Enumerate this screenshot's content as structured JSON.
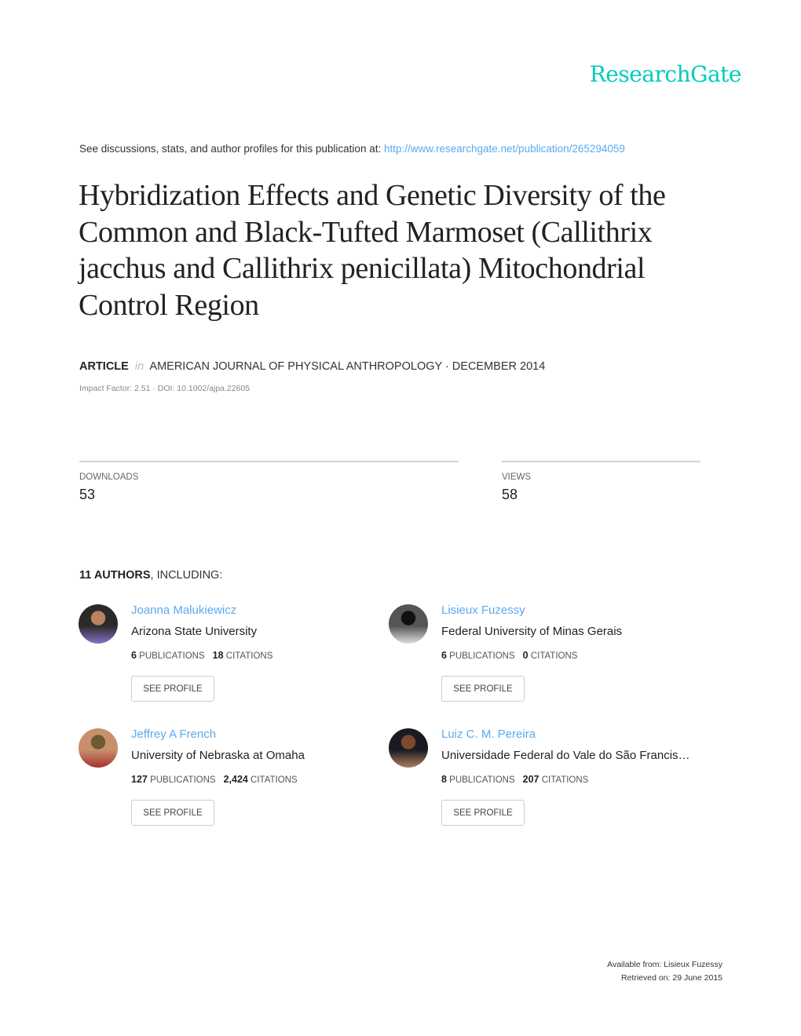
{
  "brand": {
    "name": "ResearchGate",
    "color": "#00ccbb"
  },
  "header": {
    "prefix": "See discussions, stats, and author profiles for this publication at: ",
    "url": "http://www.researchgate.net/publication/265294059"
  },
  "publication": {
    "title": "Hybridization Effects and Genetic Diversity of the Common and Black-Tufted Marmoset (Callithrix jacchus and Callithrix penicillata) Mitochondrial Control Region",
    "type": "ARTICLE",
    "in_label": "in",
    "venue": "AMERICAN JOURNAL OF PHYSICAL ANTHROPOLOGY · DECEMBER 2014",
    "impact_line": "Impact Factor: 2.51 · DOI: 10.1002/ajpa.22605"
  },
  "stats": {
    "downloads_label": "DOWNLOADS",
    "downloads_value": "53",
    "views_label": "VIEWS",
    "views_value": "58"
  },
  "authors_section": {
    "count_label": "11 AUTHORS",
    "suffix": ", INCLUDING:"
  },
  "authors": [
    {
      "name": "Joanna Malukiewicz",
      "institution": "Arizona State University",
      "publications": "6",
      "citations": "18",
      "publications_label": "PUBLICATIONS",
      "citations_label": "CITATIONS",
      "button": "SEE PROFILE",
      "avatar_colors": [
        "#b9835e",
        "#2a2a2a",
        "#8a6fc9"
      ]
    },
    {
      "name": "Lisieux Fuzessy",
      "institution": "Federal University of Minas Gerais",
      "publications": "6",
      "citations": "0",
      "publications_label": "PUBLICATIONS",
      "citations_label": "CITATIONS",
      "button": "SEE PROFILE",
      "avatar_colors": [
        "#111111",
        "#555555",
        "#dddddd"
      ]
    },
    {
      "name": "Jeffrey A French",
      "institution": "University of Nebraska at Omaha",
      "publications": "127",
      "citations": "2,424",
      "publications_label": "PUBLICATIONS",
      "citations_label": "CITATIONS",
      "button": "SEE PROFILE",
      "avatar_colors": [
        "#6e5a32",
        "#c8906a",
        "#a83030"
      ]
    },
    {
      "name": "Luiz C. M. Pereira",
      "institution": "Universidade Federal do Vale do São Francis…",
      "publications": "8",
      "citations": "207",
      "publications_label": "PUBLICATIONS",
      "citations_label": "CITATIONS",
      "button": "SEE PROFILE",
      "avatar_colors": [
        "#7a4a30",
        "#1a1a22",
        "#b08060"
      ]
    }
  ],
  "footer": {
    "available_from": "Available from: Lisieux Fuzessy",
    "retrieved_on": "Retrieved on: 29 June 2015"
  }
}
